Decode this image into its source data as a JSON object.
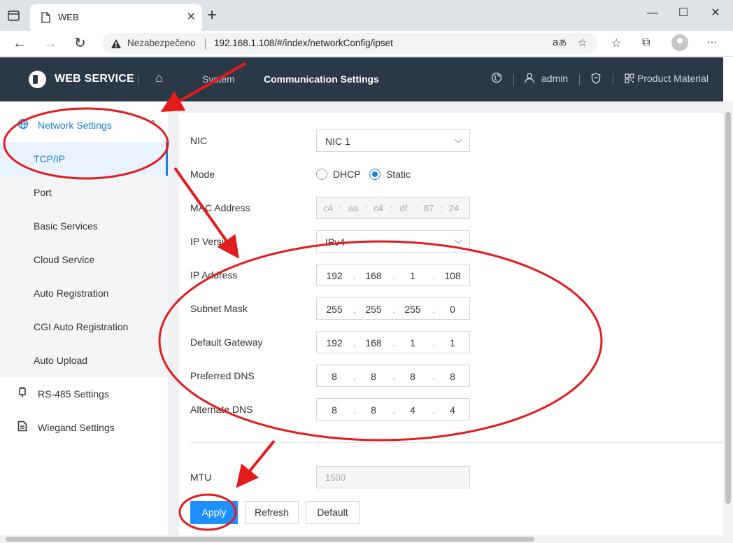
{
  "browser": {
    "tab_title": "WEB",
    "tab_close": "×",
    "new_tab": "+",
    "security_label": "Nezabezpečeno",
    "url": "192.168.1.108/#/index/networkConfig/ipset",
    "win_minimize": "—",
    "win_maximize": "☐",
    "win_close": "✕",
    "nav": {
      "back": "←",
      "forward": "→",
      "reload": "↻",
      "more": "···"
    }
  },
  "header": {
    "brand": "WEB SERVICE",
    "menu": [
      {
        "label": "System"
      },
      {
        "label": "Communication Settings"
      }
    ],
    "user": "admin",
    "product": "Product Material"
  },
  "sidebar": {
    "groups": [
      {
        "label": "Network Settings",
        "icon": "globe-icon",
        "expanded": true
      },
      {
        "label": "RS-485 Settings",
        "icon": "plug-icon"
      },
      {
        "label": "Wiegand Settings",
        "icon": "document-icon"
      }
    ],
    "subitems": [
      {
        "label": "TCP/IP",
        "active": true
      },
      {
        "label": "Port"
      },
      {
        "label": "Basic Services"
      },
      {
        "label": "Cloud Service"
      },
      {
        "label": "Auto Registration"
      },
      {
        "label": "CGI Auto Registration"
      },
      {
        "label": "Auto Upload"
      }
    ]
  },
  "form": {
    "nic": {
      "label": "NIC",
      "value": "NIC 1"
    },
    "mode": {
      "label": "Mode",
      "options": [
        "DHCP",
        "Static"
      ],
      "selected": "Static"
    },
    "mac": {
      "label": "MAC Address",
      "octets": [
        "c4",
        "aa",
        "c4",
        "df",
        "87",
        "24"
      ]
    },
    "ip_version": {
      "label": "IP Version",
      "value": "IPv4"
    },
    "ip_address": {
      "label": "IP Address",
      "octets": [
        "192",
        "168",
        "1",
        "108"
      ]
    },
    "subnet_mask": {
      "label": "Subnet Mask",
      "octets": [
        "255",
        "255",
        "255",
        "0"
      ]
    },
    "default_gateway": {
      "label": "Default Gateway",
      "octets": [
        "192",
        "168",
        "1",
        "1"
      ]
    },
    "preferred_dns": {
      "label": "Preferred DNS",
      "octets": [
        "8",
        "8",
        "8",
        "8"
      ]
    },
    "alternate_dns": {
      "label": "Alternate DNS",
      "octets": [
        "8",
        "8",
        "4",
        "4"
      ]
    },
    "mtu": {
      "label": "MTU",
      "placeholder": "1500"
    },
    "buttons": {
      "apply": "Apply",
      "refresh": "Refresh",
      "default": "Default"
    }
  },
  "colors": {
    "header_bg": "#2b3845",
    "accent": "#1e7fd8",
    "primary_button": "#1e8fff",
    "annotation": "#e31b1b"
  }
}
